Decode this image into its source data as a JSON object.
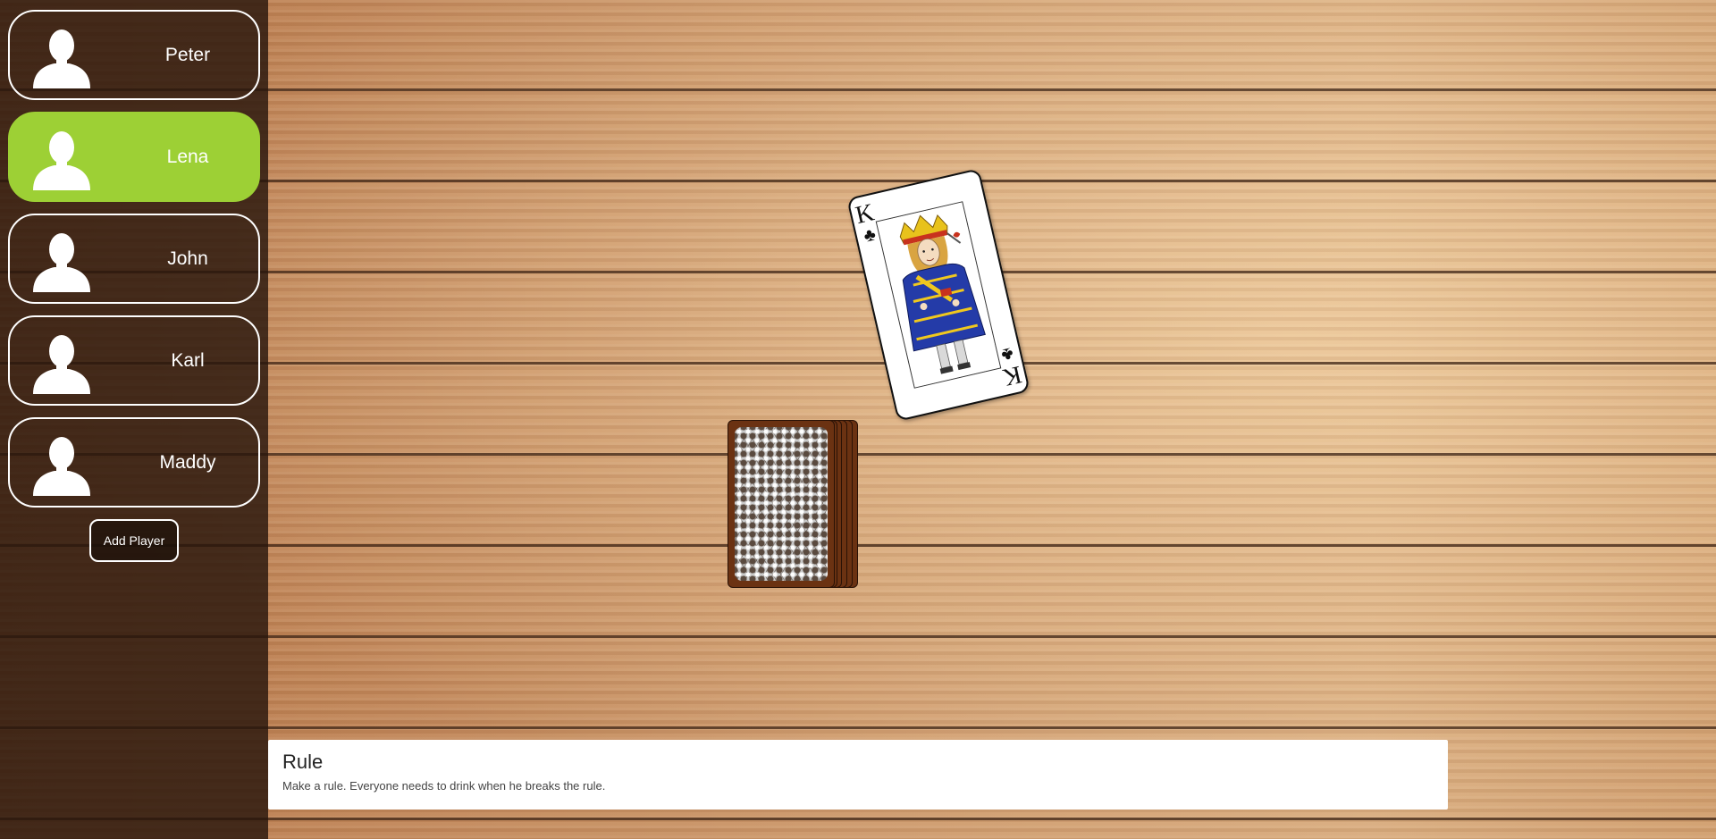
{
  "theme": {
    "active_player_color": "#9dd035",
    "sidebar_color": "#28160c",
    "card_back_color": "#6b3212"
  },
  "players": [
    {
      "name": "Peter",
      "active": false
    },
    {
      "name": "Lena",
      "active": true
    },
    {
      "name": "John",
      "active": false
    },
    {
      "name": "Karl",
      "active": false
    },
    {
      "name": "Maddy",
      "active": false
    }
  ],
  "sidebar": {
    "add_player_label": "Add Player"
  },
  "current_card": {
    "rank": "K",
    "suit": "clubs",
    "suit_symbol": "♣",
    "face": "king-of-clubs"
  },
  "deck": {
    "icon": "card-back"
  },
  "rule": {
    "title": "Rule",
    "text": "Make a rule. Everyone needs to drink when he breaks the rule."
  }
}
